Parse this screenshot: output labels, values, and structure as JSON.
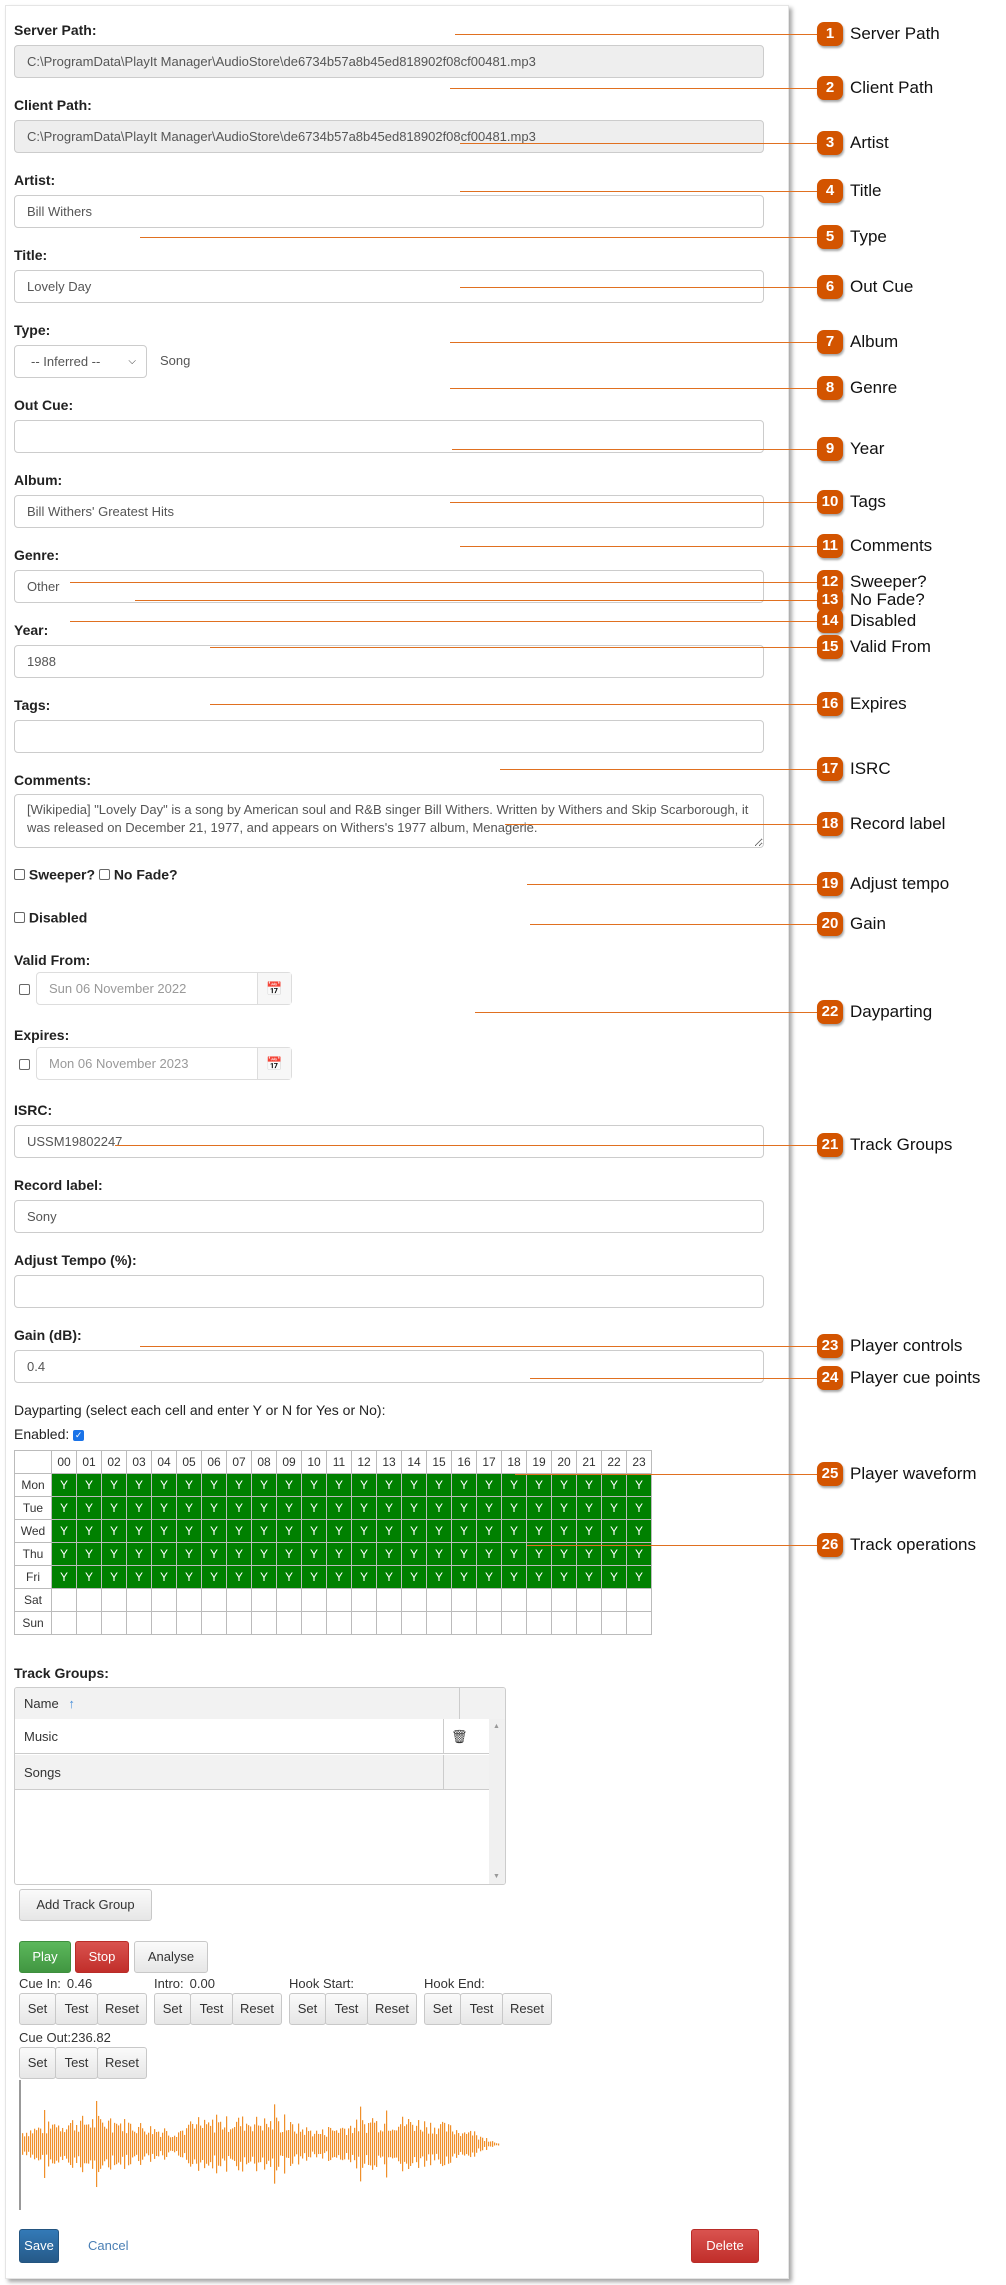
{
  "form": {
    "server_path": {
      "label": "Server Path:",
      "value": "C:\\ProgramData\\PlayIt Manager\\AudioStore\\de6734b57a8b45ed818902f08cf00481.mp3"
    },
    "client_path": {
      "label": "Client Path:",
      "value": "C:\\ProgramData\\PlayIt Manager\\AudioStore\\de6734b57a8b45ed818902f08cf00481.mp3"
    },
    "artist": {
      "label": "Artist:",
      "value": "Bill Withers"
    },
    "title": {
      "label": "Title:",
      "value": "Lovely Day"
    },
    "type": {
      "label": "Type:",
      "selected": "-- Inferred --",
      "inferred": "Song"
    },
    "out_cue": {
      "label": "Out Cue:",
      "value": ""
    },
    "album": {
      "label": "Album:",
      "value": "Bill Withers' Greatest Hits"
    },
    "genre": {
      "label": "Genre:",
      "value": "Other"
    },
    "year": {
      "label": "Year:",
      "value": "1988"
    },
    "tags": {
      "label": "Tags:",
      "value": ""
    },
    "comments": {
      "label": "Comments:",
      "value": "[Wikipedia] \"Lovely Day\" is a song by American soul and R&B singer Bill Withers. Written by Withers and Skip Scarborough, it was released on December 21, 1977, and appears on Withers's 1977 album, Menagerie."
    },
    "sweeper": {
      "label": "Sweeper?",
      "checked": false
    },
    "no_fade": {
      "label": "No Fade?",
      "checked": false
    },
    "disabled": {
      "label": "Disabled",
      "checked": false
    },
    "valid_from": {
      "label": "Valid From:",
      "checked": false,
      "value": "Sun 06 November 2022"
    },
    "expires": {
      "label": "Expires:",
      "checked": false,
      "value": "Mon 06 November 2023"
    },
    "isrc": {
      "label": "ISRC:",
      "value": "USSM19802247"
    },
    "record_label": {
      "label": "Record label:",
      "value": "Sony"
    },
    "adjust_tempo": {
      "label": "Adjust Tempo (%):",
      "value": ""
    },
    "gain": {
      "label": "Gain (dB):",
      "value": "0.4"
    }
  },
  "dayparting": {
    "label": "Dayparting (select each cell and enter Y or N for Yes or No):",
    "enabled_label": "Enabled:",
    "enabled": true,
    "hours": [
      "00",
      "01",
      "02",
      "03",
      "04",
      "05",
      "06",
      "07",
      "08",
      "09",
      "10",
      "11",
      "12",
      "13",
      "14",
      "15",
      "16",
      "17",
      "18",
      "19",
      "20",
      "21",
      "22",
      "23"
    ],
    "days": [
      {
        "day": "Mon",
        "all": "Y"
      },
      {
        "day": "Tue",
        "all": "Y"
      },
      {
        "day": "Wed",
        "all": "Y"
      },
      {
        "day": "Thu",
        "all": "Y"
      },
      {
        "day": "Fri",
        "all": "Y"
      },
      {
        "day": "Sat",
        "all": ""
      },
      {
        "day": "Sun",
        "all": ""
      }
    ],
    "yes_color": "#008000"
  },
  "track_groups": {
    "label": "Track Groups:",
    "column_name": "Name",
    "sort_icon": "↑",
    "rows": [
      "Music",
      "Songs"
    ],
    "add_button": "Add Track Group"
  },
  "player": {
    "play": "Play",
    "stop": "Stop",
    "analyse": "Analyse",
    "cue_points": [
      {
        "label": "Cue In:",
        "value": "0.46"
      },
      {
        "label": "Intro:",
        "value": "0.00"
      },
      {
        "label": "Hook Start:",
        "value": ""
      },
      {
        "label": "Hook End:",
        "value": ""
      },
      {
        "label": "Cue Out:",
        "value": "236.82"
      }
    ],
    "set": "Set",
    "test": "Test",
    "reset": "Reset",
    "waveform_color": "#f0902a"
  },
  "operations": {
    "save": "Save",
    "cancel": "Cancel",
    "delete": "Delete"
  },
  "callouts": [
    {
      "n": "1",
      "text": "Server Path"
    },
    {
      "n": "2",
      "text": "Client Path"
    },
    {
      "n": "3",
      "text": "Artist"
    },
    {
      "n": "4",
      "text": "Title"
    },
    {
      "n": "5",
      "text": "Type"
    },
    {
      "n": "6",
      "text": "Out Cue"
    },
    {
      "n": "7",
      "text": "Album"
    },
    {
      "n": "8",
      "text": "Genre"
    },
    {
      "n": "9",
      "text": "Year"
    },
    {
      "n": "10",
      "text": "Tags"
    },
    {
      "n": "11",
      "text": "Comments"
    },
    {
      "n": "12",
      "text": "Sweeper?"
    },
    {
      "n": "13",
      "text": "No Fade?"
    },
    {
      "n": "14",
      "text": "Disabled"
    },
    {
      "n": "15",
      "text": "Valid From"
    },
    {
      "n": "16",
      "text": "Expires"
    },
    {
      "n": "17",
      "text": "ISRC"
    },
    {
      "n": "18",
      "text": "Record label"
    },
    {
      "n": "19",
      "text": "Adjust tempo"
    },
    {
      "n": "20",
      "text": "Gain"
    },
    {
      "n": "22",
      "text": "Dayparting"
    },
    {
      "n": "21",
      "text": "Track Groups"
    },
    {
      "n": "23",
      "text": "Player controls"
    },
    {
      "n": "24",
      "text": "Player cue points"
    },
    {
      "n": "25",
      "text": "Player waveform"
    },
    {
      "n": "26",
      "text": "Track operations"
    }
  ],
  "callout_color": "#d35400"
}
